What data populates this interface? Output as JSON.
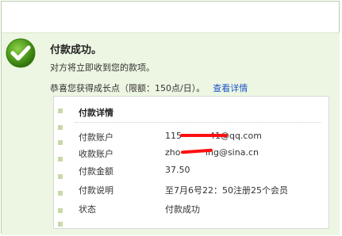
{
  "result": {
    "title": "付款成功。",
    "subtitle": "对方将立即收到您的款项。",
    "growth_text": "恭喜您获得成长点（限额：150点/日）。",
    "growth_link": "查看详情"
  },
  "details": {
    "title": "付款详情",
    "rows": [
      {
        "label": "付款账户",
        "value": "115          41@qq.com"
      },
      {
        "label": "收款账户",
        "value": "zho         ing@sina.cn"
      },
      {
        "label": "付款金额",
        "value": "37.50"
      },
      {
        "label": "付款说明",
        "value": "至7月6号22：50注册25个会员"
      },
      {
        "label": "状态",
        "value": "付款成功"
      }
    ]
  },
  "colors": {
    "panel_bg": "#edf6e2",
    "accent_green": "#4f9a1c",
    "link_blue": "#1a56c8",
    "redaction_red": "#ff1010"
  },
  "icons": {
    "success": "check-circle-icon",
    "bullet": "square-bullet-icon"
  }
}
